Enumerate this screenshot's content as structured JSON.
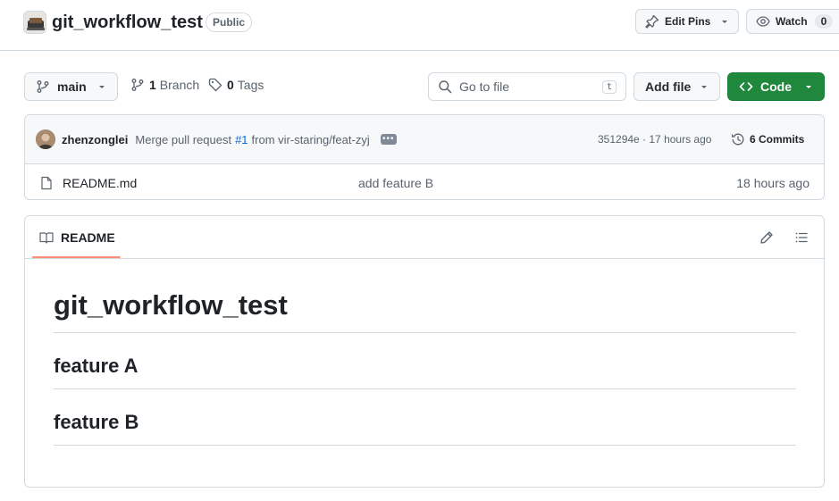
{
  "repo": {
    "name": "git_workflow_test",
    "visibility": "Public"
  },
  "header_actions": {
    "edit_pins_label": "Edit Pins",
    "watch_label": "Watch",
    "watch_count": "0"
  },
  "controls": {
    "branch_label": "main",
    "branches_count": "1",
    "branches_label": "Branch",
    "tags_count": "0",
    "tags_label": "Tags",
    "goto_placeholder": "Go to file",
    "goto_shortcut": "t",
    "add_file_label": "Add file",
    "code_label": "Code"
  },
  "latest_commit": {
    "author": "zhenzonglei",
    "message_prefix": "Merge pull request",
    "pr_ref": "#1",
    "message_suffix": "from vir-staring/feat-zyj",
    "sha_and_time": "351294e · 17 hours ago",
    "commits_label": "6 Commits"
  },
  "files": [
    {
      "name": "README.md",
      "commit_message": "add feature B",
      "age": "18 hours ago"
    }
  ],
  "readme": {
    "tab_label": "README",
    "title": "git_workflow_test",
    "headings": [
      "feature A",
      "feature B"
    ]
  },
  "colors": {
    "primary_green": "#1f883d",
    "link_blue": "#0969da",
    "tab_underline": "#fd8c73",
    "border": "#d1d9e0"
  },
  "icons": {
    "repo_avatar": "repo-owner-avatar",
    "pin": "pin-icon",
    "eye": "eye-icon",
    "branch": "git-branch-icon",
    "tag": "tag-icon",
    "search": "search-icon",
    "code": "code-icon",
    "history": "history-icon",
    "file": "file-icon",
    "book": "book-icon",
    "pencil": "pencil-icon",
    "outline": "list-unordered-icon"
  }
}
